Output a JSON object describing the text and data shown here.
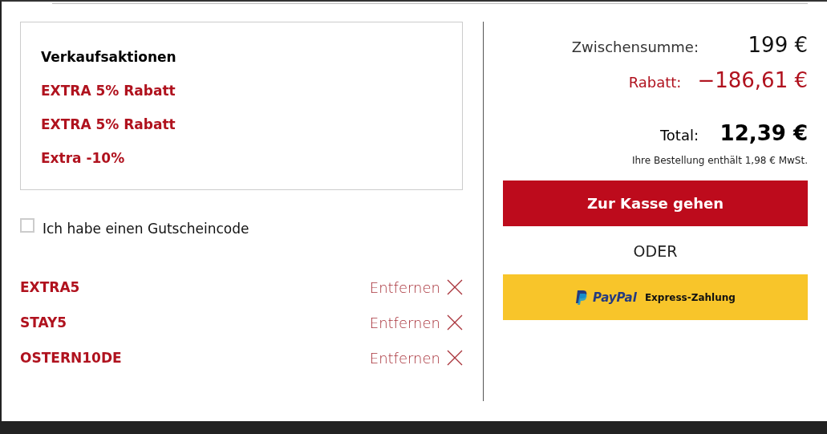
{
  "promotions": {
    "title": "Verkaufsaktionen",
    "items": [
      "EXTRA 5% Rabatt",
      "EXTRA 5% Rabatt",
      "Extra -10%"
    ]
  },
  "voucher": {
    "label": "Ich habe einen Gutscheincode",
    "checked": false
  },
  "codes": [
    {
      "code": "EXTRA5",
      "action": "Entfernen"
    },
    {
      "code": "STAY5",
      "action": "Entfernen"
    },
    {
      "code": "OSTERN10DE",
      "action": "Entfernen"
    }
  ],
  "summary": {
    "subtotal_label": "Zwischensumme:",
    "subtotal": "199 €",
    "discount_label": "Rabatt:",
    "discount": "−186,61 €",
    "total_label": "Total:",
    "total": "12,39 €",
    "vat_note": "Ihre Bestellung enthält 1,98 € MwSt."
  },
  "checkout_button": "Zur Kasse gehen",
  "or_label": "ODER",
  "paypal": {
    "brand": "PayPal",
    "label": "Express-Zahlung"
  }
}
